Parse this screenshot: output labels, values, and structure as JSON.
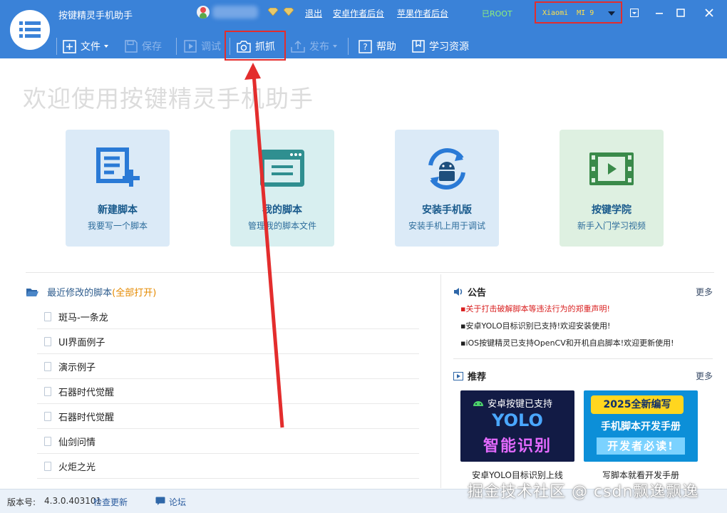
{
  "app": {
    "title": "按键精灵手机助手"
  },
  "header": {
    "links": {
      "logout": "退出",
      "android_backend": "安卓作者后台",
      "apple_backend": "苹果作者后台"
    },
    "root_status": "已ROOT",
    "device": {
      "name": "Xiaomi  MI 9"
    }
  },
  "toolbar": {
    "file": "文件",
    "save": "保存",
    "debug": "调试",
    "capture": "抓抓",
    "publish": "发布",
    "help": "帮助",
    "learn": "学习资源"
  },
  "welcome": "欢迎使用按键精灵手机助手",
  "cards": [
    {
      "title": "新建脚本",
      "subtitle": "我要写一个脚本"
    },
    {
      "title": "我的脚本",
      "subtitle": "管理我的脚本文件"
    },
    {
      "title": "安装手机版",
      "subtitle": "安装手机上用于调试"
    },
    {
      "title": "按键学院",
      "subtitle": "新手入门学习视频"
    }
  ],
  "recent": {
    "title": "最近修改的脚本",
    "open_all": "(全部打开)",
    "items": [
      "斑马-一条龙",
      "UI界面例子",
      "演示例子",
      "石器时代觉醒",
      "石器时代觉醒",
      "仙剑问情",
      "火炬之光"
    ]
  },
  "announcements": {
    "title": "公告",
    "more": "更多",
    "items": [
      "关于打击破解脚本等违法行为的郑重声明!",
      "安卓YOLO目标识别已支持!欢迎安装使用!",
      "iOS按键精灵已支持OpenCV和开机自启脚本!欢迎更新使用!"
    ]
  },
  "recommend": {
    "title": "推荐",
    "more": "更多",
    "promos": [
      {
        "line1": "安卓按键已支持",
        "line2": "YOLO",
        "line3": "智能识别",
        "caption": "安卓YOLO目标识别上线"
      },
      {
        "line1": "2025全新编写",
        "line2": "手机脚本开发手册",
        "line3": "开发者必读!",
        "caption": "写脚本就看开发手册"
      }
    ]
  },
  "statusbar": {
    "version_label": "版本号:",
    "version": "4.3.0.403101",
    "check_update": "检查更新",
    "forum": "论坛"
  },
  "watermark": "掘金技术社区 @ csdn飘逸飘逸",
  "colors": {
    "header": "#3a82d8",
    "highlight_red": "#e32d2d",
    "device_text": "#ffe14a",
    "root_text": "#8ef07a",
    "notice_red": "#d91f1f"
  }
}
